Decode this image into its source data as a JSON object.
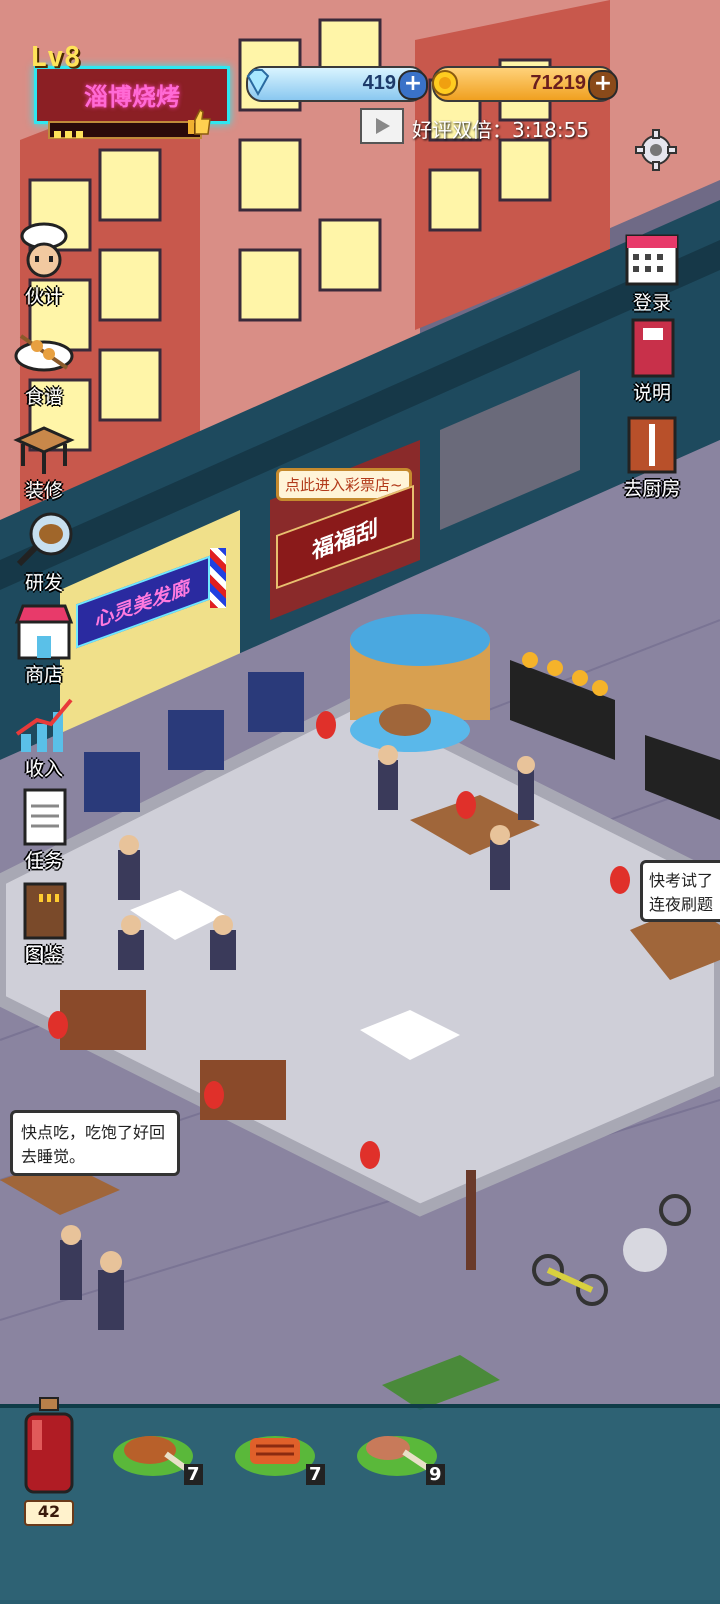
{
  "hud": {
    "level": "Lv8",
    "shop_name": "淄博烧烤",
    "gems": "419",
    "coins": "71219",
    "double_reward_text": "好评双倍：3:18:55"
  },
  "side_menu_left": [
    {
      "label": "伙计",
      "icon": "chef-icon"
    },
    {
      "label": "食谱",
      "icon": "recipe-icon"
    },
    {
      "label": "装修",
      "icon": "decorate-icon"
    },
    {
      "label": "研发",
      "icon": "research-icon"
    },
    {
      "label": "商店",
      "icon": "shop-icon"
    },
    {
      "label": "收入",
      "icon": "income-icon"
    },
    {
      "label": "任务",
      "icon": "task-icon"
    },
    {
      "label": "图鉴",
      "icon": "handbook-icon"
    }
  ],
  "side_menu_right": [
    {
      "label": "登录",
      "icon": "calendar-icon"
    },
    {
      "label": "说明",
      "icon": "book-icon"
    },
    {
      "label": "去厨房",
      "icon": "door-icon"
    }
  ],
  "scene": {
    "lottery_tag": "点此进入彩票店~",
    "lottery_sign": "福福刮",
    "barber_sign": "心灵美发廊",
    "customer_speech": "快点吃，吃饱了好回去睡觉。",
    "edge_speech_line1": "快考试了",
    "edge_speech_line2": "连夜刷题"
  },
  "inventory": {
    "bottle_count": "42",
    "items": [
      {
        "name": "roast-leg",
        "count": "7"
      },
      {
        "name": "grilled-fish",
        "count": "7"
      },
      {
        "name": "skewer-meat",
        "count": "9"
      }
    ]
  }
}
